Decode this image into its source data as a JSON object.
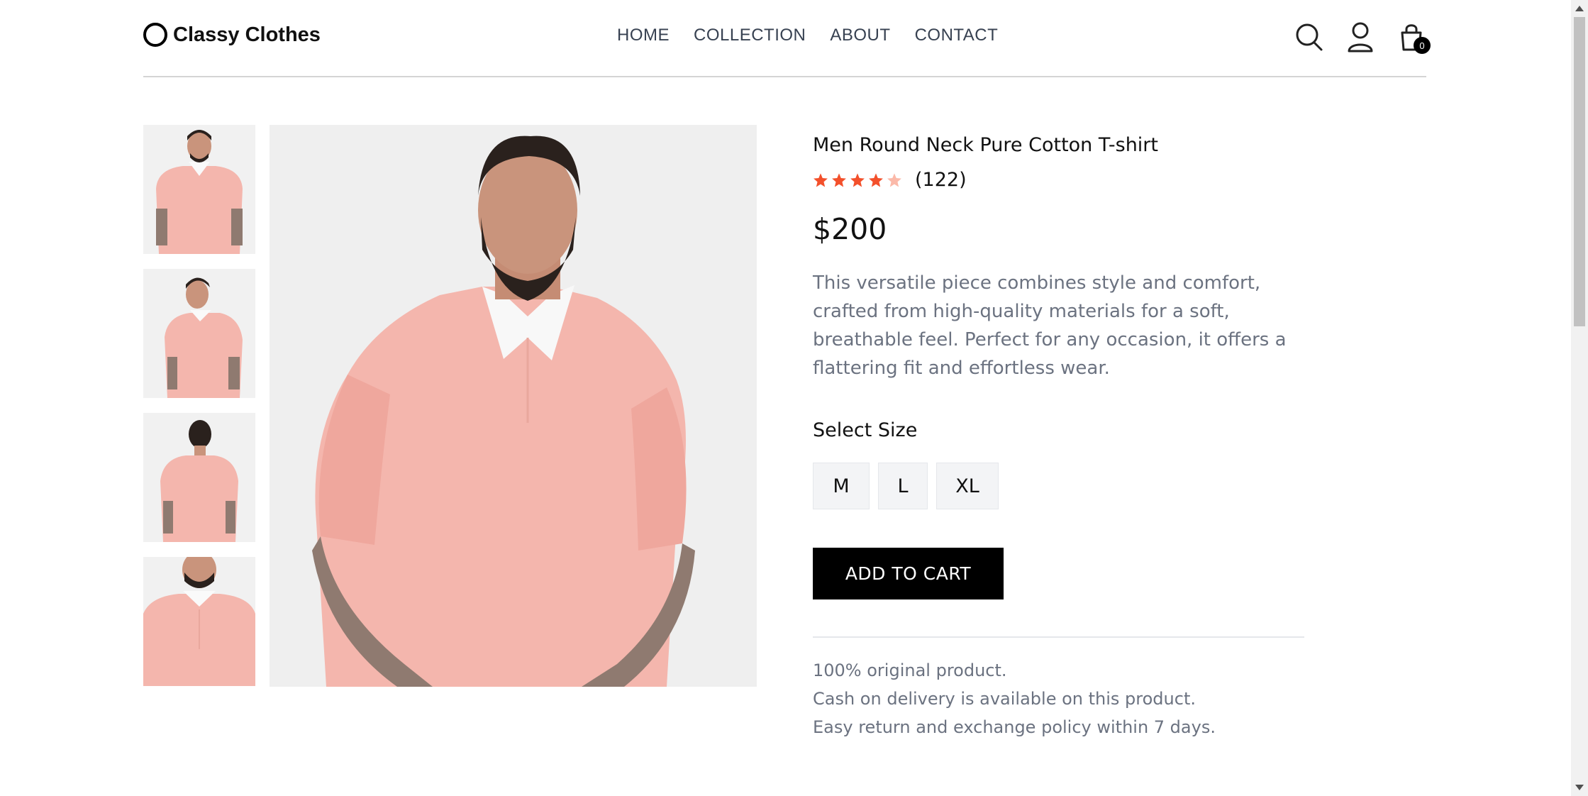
{
  "brand": {
    "name": "Classy Clothes"
  },
  "nav": {
    "items": [
      "HOME",
      "COLLECTION",
      "ABOUT",
      "CONTACT"
    ]
  },
  "cart": {
    "count": "0"
  },
  "icons": {
    "search": "search-icon",
    "profile": "user-icon",
    "cart": "shopping-bag-icon",
    "star": "star-icon"
  },
  "product": {
    "title": "Men Round Neck Pure Cotton T-shirt",
    "rating": 4,
    "rating_max": 5,
    "review_count": "(122)",
    "price": "$200",
    "description": "This versatile piece combines style and comfort, crafted from high-quality materials for a soft, breathable feel. Perfect for any occasion, it offers a flattering fit and effortless wear.",
    "size_label": "Select Size",
    "sizes": [
      "M",
      "L",
      "XL"
    ],
    "add_to_cart": "ADD TO CART",
    "policies": [
      "100% original product.",
      "Cash on delivery is available on this product.",
      "Easy return and exchange policy within 7 days."
    ]
  },
  "colors": {
    "star_filled": "#f3502b",
    "star_empty": "#fbb9a9",
    "shirt": "#f4b6ad",
    "button": "#000000"
  }
}
